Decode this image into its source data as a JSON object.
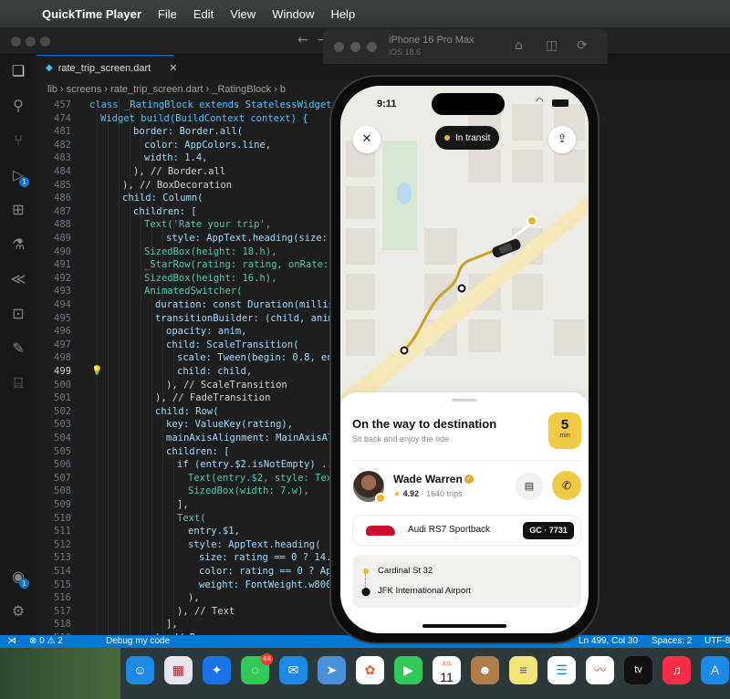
{
  "menubar": {
    "app_name": "QuickTime Player",
    "items": [
      "File",
      "Edit",
      "View",
      "Window",
      "Help"
    ]
  },
  "vscode": {
    "tab": {
      "filename": "rate_trip_screen.dart",
      "close": "✕"
    },
    "breadcrumb": "lib  ›  screens  ›  rate_trip_screen.dart  ›  _RatingBlock  ›  b",
    "activity_badges": [
      "1",
      "1"
    ],
    "lines": [
      {
        "n": "457",
        "t": "class _RatingBlock extends StatelessWidget {",
        "ind": 0
      },
      {
        "n": "474",
        "t": "Widget build(BuildContext context) {",
        "ind": 1
      },
      {
        "n": "481",
        "t": "border: Border.all(",
        "ind": 4
      },
      {
        "n": "482",
        "t": "color: AppColors.line,",
        "ind": 5
      },
      {
        "n": "483",
        "t": "width: 1.4,",
        "ind": 5
      },
      {
        "n": "484",
        "t": "), // Border.all",
        "ind": 4
      },
      {
        "n": "485",
        "t": "), // BoxDecoration",
        "ind": 3
      },
      {
        "n": "486",
        "t": "child: Column(",
        "ind": 3
      },
      {
        "n": "487",
        "t": "children: [",
        "ind": 4
      },
      {
        "n": "488",
        "t": "Text('Rate your trip',",
        "ind": 5
      },
      {
        "n": "489",
        "t": "style: AppText.heading(size: 17",
        "ind": 7
      },
      {
        "n": "490",
        "t": "SizedBox(height: 18.h),",
        "ind": 5
      },
      {
        "n": "491",
        "t": "_StarRow(rating: rating, onRate: on",
        "ind": 5
      },
      {
        "n": "492",
        "t": "SizedBox(height: 16.h),",
        "ind": 5
      },
      {
        "n": "493",
        "t": "AnimatedSwitcher(",
        "ind": 5
      },
      {
        "n": "494",
        "t": "duration: const Duration(millisec",
        "ind": 6
      },
      {
        "n": "495",
        "t": "transitionBuilder: (child, anim)",
        "ind": 6
      },
      {
        "n": "496",
        "t": "opacity: anim,",
        "ind": 7
      },
      {
        "n": "497",
        "t": "child: ScaleTransition(",
        "ind": 7
      },
      {
        "n": "498",
        "t": "scale: Tween(begin: 0.8, end:",
        "ind": 8
      },
      {
        "n": "499",
        "t": "child: child,",
        "ind": 8
      },
      {
        "n": "500",
        "t": "), // ScaleTransition",
        "ind": 7
      },
      {
        "n": "501",
        "t": "), // FadeTransition",
        "ind": 6
      },
      {
        "n": "502",
        "t": "child: Row(",
        "ind": 6
      },
      {
        "n": "503",
        "t": "key: ValueKey(rating),",
        "ind": 7
      },
      {
        "n": "504",
        "t": "mainAxisAlignment: MainAxisAlig",
        "ind": 7
      },
      {
        "n": "505",
        "t": "children: [",
        "ind": 7
      },
      {
        "n": "506",
        "t": "if (entry.$2.isNotEmpty) ...[",
        "ind": 8
      },
      {
        "n": "507",
        "t": "Text(entry.$2, style: TextS",
        "ind": 9
      },
      {
        "n": "508",
        "t": "SizedBox(width: 7.w),",
        "ind": 9
      },
      {
        "n": "509",
        "t": "],",
        "ind": 8
      },
      {
        "n": "510",
        "t": "Text(",
        "ind": 8
      },
      {
        "n": "511",
        "t": "entry.$1,",
        "ind": 9
      },
      {
        "n": "512",
        "t": "style: AppText.heading(",
        "ind": 9
      },
      {
        "n": "513",
        "t": "size: rating == 0 ? 14.5",
        "ind": 10
      },
      {
        "n": "514",
        "t": "color: rating == 0 ? Ap",
        "ind": 10
      },
      {
        "n": "515",
        "t": "weight: FontWeight.w800,",
        "ind": 10
      },
      {
        "n": "516",
        "t": "),",
        "ind": 9
      },
      {
        "n": "517",
        "t": "), // Text",
        "ind": 8
      },
      {
        "n": "518",
        "t": "],",
        "ind": 7
      },
      {
        "n": "519",
        "t": "), // Row",
        "ind": 6
      }
    ],
    "active_line": "499",
    "status": {
      "problems": "⊗ 0 ⚠ 2",
      "debug": "Debug my code",
      "position": "Ln 499, Col 30",
      "spaces": "Spaces: 2",
      "encoding": "UTF-8"
    }
  },
  "simulator": {
    "device": "iPhone 16 Pro Max",
    "os": "iOS 18.6"
  },
  "app": {
    "time": "9:11",
    "status_pill": "In transit",
    "sheet": {
      "title": "On the way to destination",
      "subtitle": "Sit back and enjoy the ride",
      "eta_value": "5",
      "eta_unit": "min"
    },
    "driver": {
      "name": "Wade Warren",
      "rating": "4.92",
      "trips": "1640 trips"
    },
    "vehicle": {
      "name": "Audi RS7 Sportback",
      "plate": "GC · 7731"
    },
    "route": {
      "from": "Cardinal St 32",
      "to": "JFK International Airport"
    }
  },
  "dock": {
    "messages_badge": "48",
    "calendar_month": "JUL",
    "calendar_day": "11",
    "tv_label": "tv"
  },
  "colors": {
    "accent_yellow": "#f2c945",
    "vscode_blue": "#0078d4",
    "vehicle_red": "#c8102e"
  }
}
